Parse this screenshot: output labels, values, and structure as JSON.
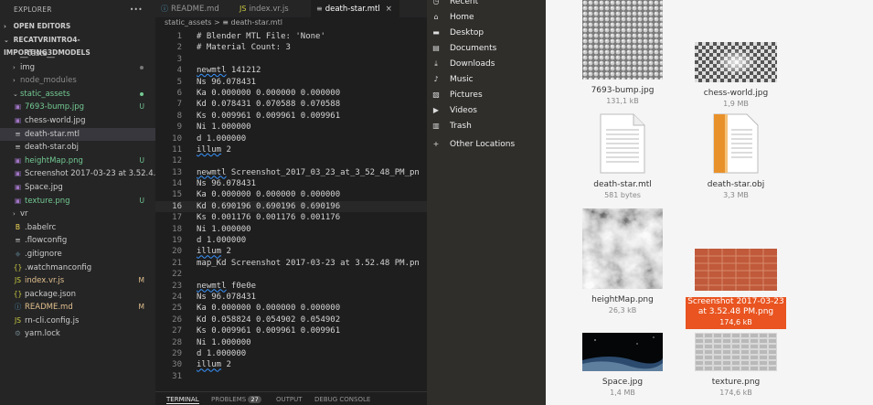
{
  "explorer": {
    "title": "EXPLORER",
    "open_editors": "OPEN EDITORS",
    "project": "RECATVRINTRO4-IMPORTING3DMODELS",
    "tree": [
      {
        "label": "__tests__",
        "kind": "folder",
        "depth": 1,
        "open": false,
        "color": "#cccccc"
      },
      {
        "label": "img",
        "kind": "folder",
        "depth": 1,
        "open": false,
        "color": "#cccccc",
        "dot": true
      },
      {
        "label": "node_modules",
        "kind": "folder",
        "depth": 1,
        "open": false,
        "color": "#8b8b8b"
      },
      {
        "label": "static_assets",
        "kind": "folder",
        "depth": 1,
        "open": true,
        "color": "#73c991",
        "dot": true
      },
      {
        "label": "7693-bump.jpg",
        "kind": "image",
        "depth": 2,
        "color": "#73c991",
        "badge": "U"
      },
      {
        "label": "chess-world.jpg",
        "kind": "image",
        "depth": 2,
        "color": "#cccccc"
      },
      {
        "label": "death-star.mtl",
        "kind": "lines",
        "depth": 2,
        "color": "#cccccc",
        "selected": true
      },
      {
        "label": "death-star.obj",
        "kind": "lines",
        "depth": 2,
        "color": "#cccccc"
      },
      {
        "label": "heightMap.png",
        "kind": "image",
        "depth": 2,
        "color": "#73c991",
        "badge": "U"
      },
      {
        "label": "Screenshot 2017-03-23 at 3.52.4...",
        "kind": "image",
        "depth": 2,
        "color": "#cccccc"
      },
      {
        "label": "Space.jpg",
        "kind": "image",
        "depth": 2,
        "color": "#cccccc"
      },
      {
        "label": "texture.png",
        "kind": "image",
        "depth": 2,
        "color": "#73c991",
        "badge": "U"
      },
      {
        "label": "vr",
        "kind": "folder",
        "depth": 1,
        "open": false,
        "color": "#cccccc"
      },
      {
        "label": ".babelrc",
        "kind": "babel",
        "depth": 1,
        "color": "#cccccc"
      },
      {
        "label": ".flowconfig",
        "kind": "lines",
        "depth": 1,
        "color": "#cccccc"
      },
      {
        "label": ".gitignore",
        "kind": "git",
        "depth": 1,
        "color": "#cccccc"
      },
      {
        "label": ".watchmanconfig",
        "kind": "json",
        "depth": 1,
        "color": "#cccccc"
      },
      {
        "label": "index.vr.js",
        "kind": "js",
        "depth": 1,
        "color": "#e2c08d",
        "badge": "M"
      },
      {
        "label": "package.json",
        "kind": "json",
        "depth": 1,
        "color": "#cccccc"
      },
      {
        "label": "README.md",
        "kind": "info",
        "depth": 1,
        "color": "#e2c08d",
        "badge": "M"
      },
      {
        "label": "rn-cli.config.js",
        "kind": "js",
        "depth": 1,
        "color": "#cccccc"
      },
      {
        "label": "yarn.lock",
        "kind": "lock",
        "depth": 1,
        "color": "#cccccc"
      }
    ]
  },
  "editor": {
    "tabs": [
      {
        "label": "README.md",
        "icon": "info-icon",
        "active": false
      },
      {
        "label": "index.vr.js",
        "icon": "js-icon",
        "active": false
      },
      {
        "label": "death-star.mtl",
        "icon": "lines-icon",
        "active": true,
        "close": "×"
      }
    ],
    "breadcrumb": {
      "folder": "static_assets",
      "sep": ">",
      "file": "death-star.mtl"
    },
    "lines": [
      {
        "n": "1",
        "t": "# Blender MTL File: 'None'"
      },
      {
        "n": "2",
        "t": "# Material Count: 3"
      },
      {
        "n": "3",
        "t": ""
      },
      {
        "n": "4",
        "t": "newmtl 141212",
        "sq": "newmtl"
      },
      {
        "n": "5",
        "t": "Ns 96.078431"
      },
      {
        "n": "6",
        "t": "Ka 0.000000 0.000000 0.000000"
      },
      {
        "n": "7",
        "t": "Kd 0.078431 0.070588 0.070588"
      },
      {
        "n": "8",
        "t": "Ks 0.009961 0.009961 0.009961"
      },
      {
        "n": "9",
        "t": "Ni 1.000000"
      },
      {
        "n": "10",
        "t": "d 1.000000"
      },
      {
        "n": "11",
        "t": "illum 2",
        "sq": "illum"
      },
      {
        "n": "12",
        "t": ""
      },
      {
        "n": "13",
        "t": "newmtl Screenshot_2017_03_23_at_3_52_48_PM_pn",
        "sq": "newmtl"
      },
      {
        "n": "14",
        "t": "Ns 96.078431"
      },
      {
        "n": "15",
        "t": "Ka 0.000000 0.000000 0.000000"
      },
      {
        "n": "16",
        "t": "Kd 0.690196 0.690196 0.690196",
        "hl": true
      },
      {
        "n": "17",
        "t": "Ks 0.001176 0.001176 0.001176"
      },
      {
        "n": "18",
        "t": "Ni 1.000000"
      },
      {
        "n": "19",
        "t": "d 1.000000"
      },
      {
        "n": "20",
        "t": "illum 2",
        "sq": "illum"
      },
      {
        "n": "21",
        "t": "map_Kd Screenshot 2017-03-23 at 3.52.48 PM.pn"
      },
      {
        "n": "22",
        "t": ""
      },
      {
        "n": "23",
        "t": "newmtl f0e0e",
        "sq": "newmtl"
      },
      {
        "n": "24",
        "t": "Ns 96.078431"
      },
      {
        "n": "25",
        "t": "Ka 0.000000 0.000000 0.000000"
      },
      {
        "n": "26",
        "t": "Kd 0.058824 0.054902 0.054902"
      },
      {
        "n": "27",
        "t": "Ks 0.009961 0.009961 0.009961"
      },
      {
        "n": "28",
        "t": "Ni 1.000000"
      },
      {
        "n": "29",
        "t": "d 1.000000"
      },
      {
        "n": "30",
        "t": "illum 2",
        "sq": "illum"
      },
      {
        "n": "31",
        "t": ""
      }
    ],
    "panel": {
      "terminal": "TERMINAL",
      "problems": "PROBLEMS",
      "problems_count": "27",
      "output": "OUTPUT",
      "debug": "DEBUG CONSOLE"
    }
  },
  "file_manager": {
    "sidebar": [
      {
        "label": "Recent",
        "icon": "clock-icon"
      },
      {
        "label": "Home",
        "icon": "home-icon"
      },
      {
        "label": "Desktop",
        "icon": "folder-icon"
      },
      {
        "label": "Documents",
        "icon": "document-icon"
      },
      {
        "label": "Downloads",
        "icon": "download-icon"
      },
      {
        "label": "Music",
        "icon": "music-icon"
      },
      {
        "label": "Pictures",
        "icon": "picture-icon"
      },
      {
        "label": "Videos",
        "icon": "video-icon"
      },
      {
        "label": "Trash",
        "icon": "trash-icon"
      },
      {
        "label": "Other Locations",
        "icon": "plus-icon"
      }
    ],
    "files": [
      {
        "name": "7693-bump.jpg",
        "size": "131,1 kB",
        "thumb": "bump"
      },
      {
        "name": "chess-world.jpg",
        "size": "1,9 MB",
        "thumb": "chess"
      },
      {
        "name": "death-star.mtl",
        "size": "581 bytes",
        "thumb": "text"
      },
      {
        "name": "death-star.obj",
        "size": "3,3 MB",
        "thumb": "obj"
      },
      {
        "name": "heightMap.png",
        "size": "26,3 kB",
        "thumb": "height"
      },
      {
        "name": "Screenshot 2017-03-23 at 3.52.48 PM.png",
        "size": "174,6 kB",
        "thumb": "screenshot",
        "selected": true
      },
      {
        "name": "Space.jpg",
        "size": "1,4 MB",
        "thumb": "space"
      },
      {
        "name": "texture.png",
        "size": "174,6 kB",
        "thumb": "texture"
      }
    ]
  }
}
